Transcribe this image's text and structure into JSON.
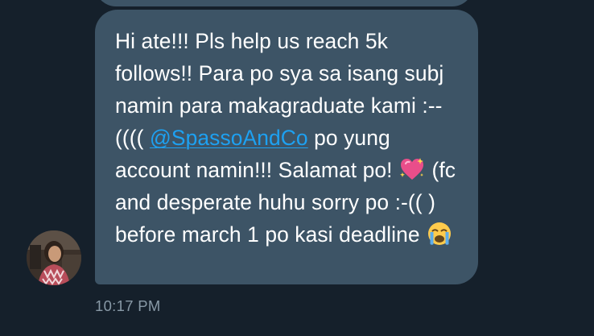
{
  "conversation": {
    "message": {
      "text_before_mention": "Hi ate!!! Pls help us reach 5k follows!! Para po sya sa isang subj namin para makagraduate kami :--(((( ",
      "mention": "@SpassoAndCo",
      "text_after_mention": " po yung account namin!!! Salamat po! ",
      "emoji_1": "sparkling-heart",
      "text_after_emoji_1": " (fc and desperate huhu sorry po :-(( ) before march 1 po kasi deadline ",
      "emoji_2": "loudly-crying-face",
      "timestamp": "10:17 PM"
    },
    "colors": {
      "background": "#15202b",
      "bubble": "#3d5466",
      "text": "#ffffff",
      "link": "#1da1f2",
      "timestamp": "#8899a6"
    }
  }
}
